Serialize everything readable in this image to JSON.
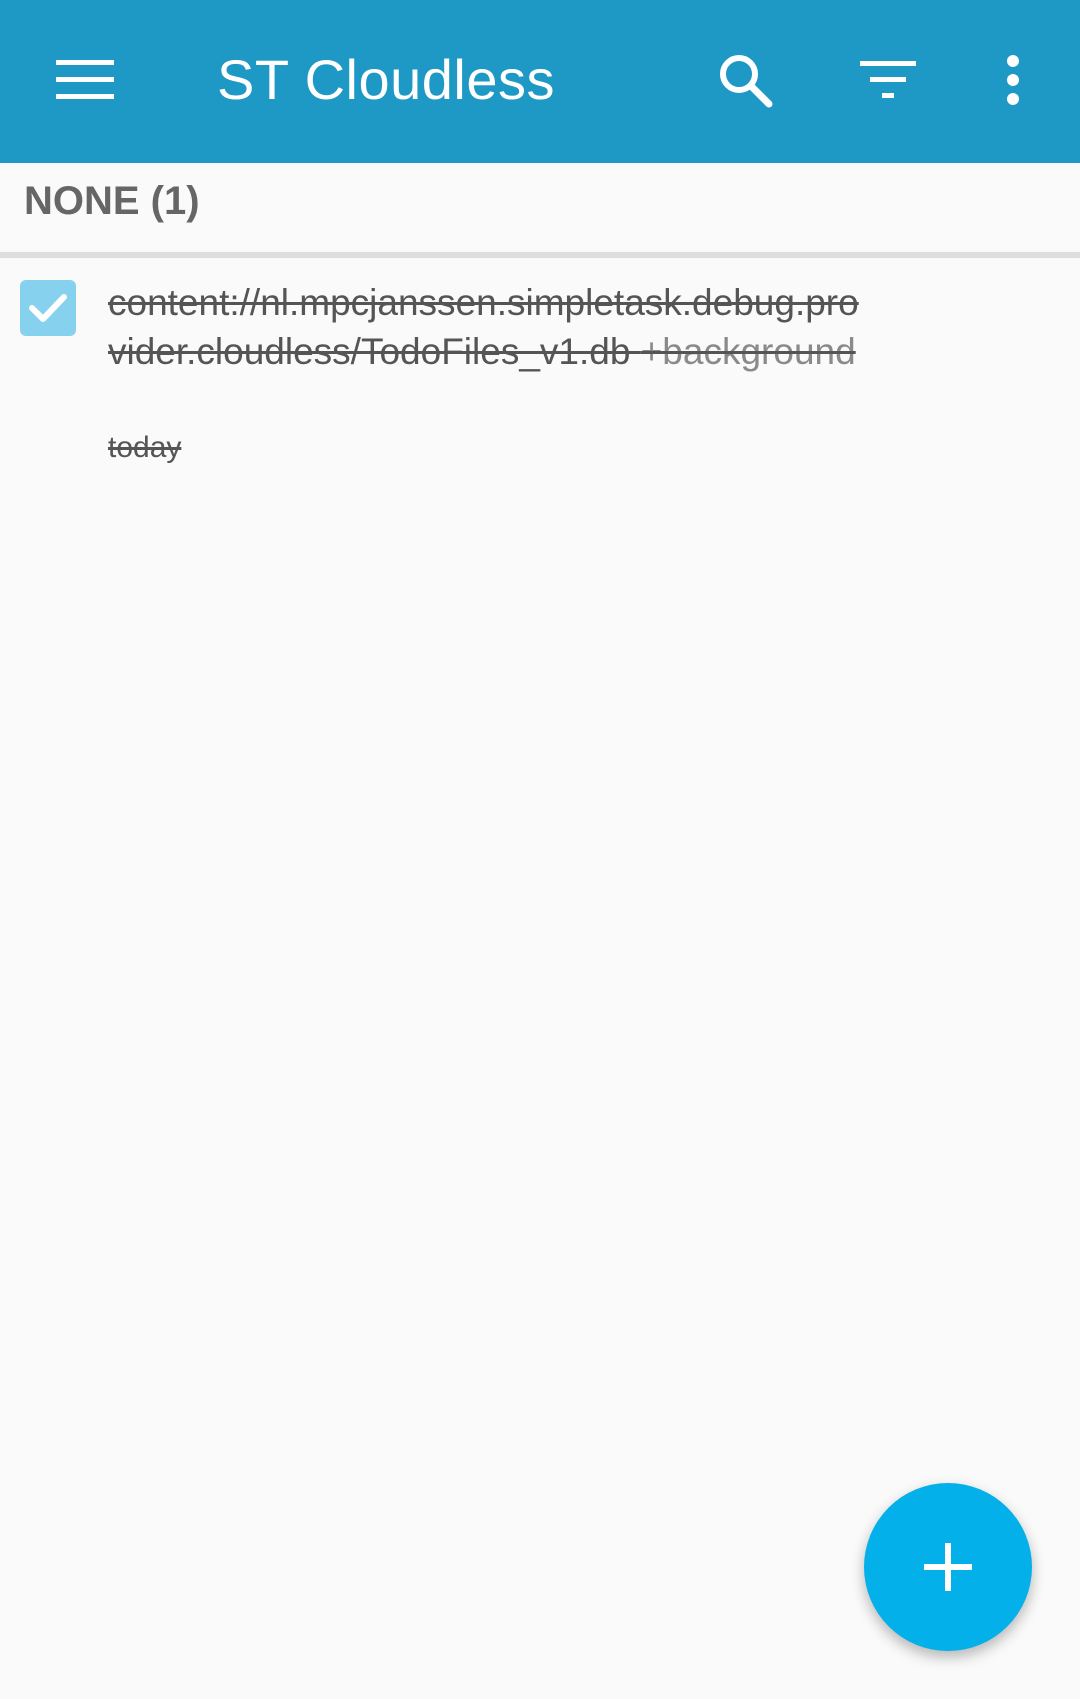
{
  "appbar": {
    "title": "ST Cloudless",
    "background_color": "#1e98c4",
    "icons": {
      "menu": "hamburger-menu-icon",
      "search": "search-icon",
      "filter": "filter-icon",
      "overflow": "more-vertical-icon"
    }
  },
  "section": {
    "header": "NONE (1)"
  },
  "tasks": [
    {
      "text_main": "content://nl.mpcjanssen.simpletask.debug.provider.cloudless/TodoFiles_v1.db ",
      "tag": "+background",
      "date": "today",
      "completed": true
    }
  ],
  "fab": {
    "icon": "plus-icon",
    "color": "#03b0ea"
  }
}
